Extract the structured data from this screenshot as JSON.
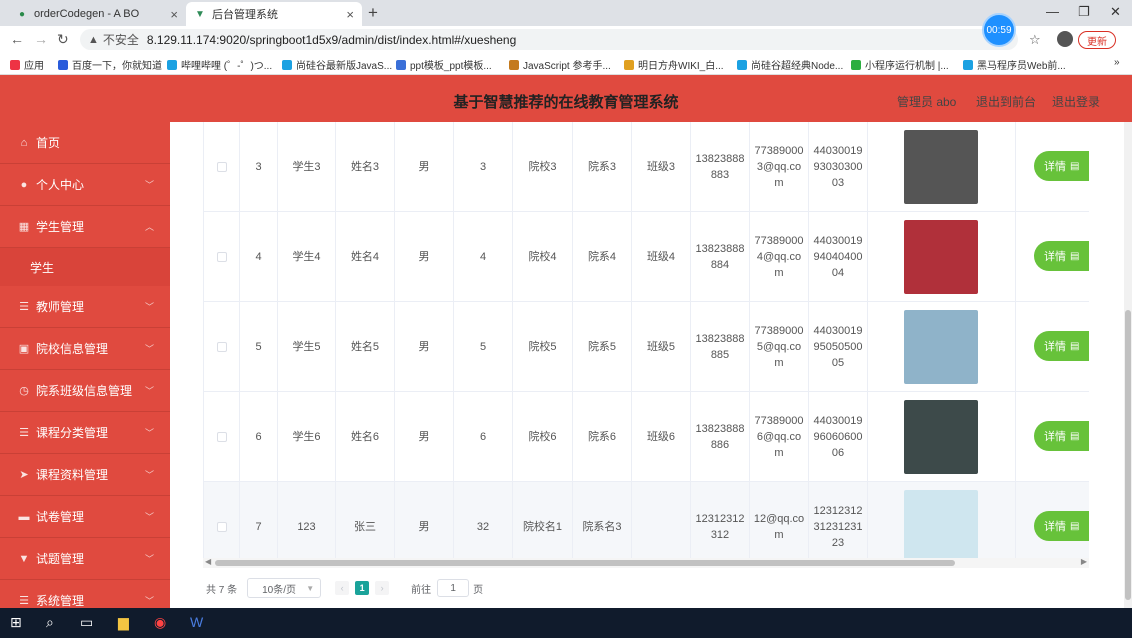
{
  "browser": {
    "tabs": [
      {
        "title": "orderCodegen - A BO",
        "icon": "github-icon"
      },
      {
        "title": "后台管理系统",
        "icon": "vue-icon"
      }
    ],
    "insecure_label": "不安全",
    "url": "8.129.11.174:9020/springboot1d5x9/admin/dist/index.html#/xuesheng",
    "timer": "00:59",
    "update_label": "更新",
    "bookmarks": [
      "应用",
      "百度一下，你就知道",
      "哔哩哔哩 (゜-゜)つ...",
      "尚硅谷最新版JavaS...",
      "ppt模板_ppt模板...",
      "JavaScript 参考手...",
      "明日方舟WIKI_白...",
      "尚硅谷超经典Node...",
      "小程序运行机制 |...",
      "黑马程序员Web前..."
    ]
  },
  "header": {
    "title": "基于智慧推荐的在线教育管理系统",
    "user": "管理员 abo",
    "back_front": "退出到前台",
    "logout": "退出登录"
  },
  "sidebar": {
    "items": [
      {
        "label": "首页",
        "icon": "home-icon"
      },
      {
        "label": "个人中心",
        "icon": "user-icon"
      },
      {
        "label": "学生管理",
        "icon": "grid-icon"
      },
      {
        "label": "教师管理",
        "icon": "list-icon"
      },
      {
        "label": "院校信息管理",
        "icon": "building-icon"
      },
      {
        "label": "院系班级信息管理",
        "icon": "clock-icon"
      },
      {
        "label": "课程分类管理",
        "icon": "list-icon"
      },
      {
        "label": "课程资料管理",
        "icon": "send-icon"
      },
      {
        "label": "试卷管理",
        "icon": "chat-icon"
      },
      {
        "label": "试题管理",
        "icon": "filter-icon"
      },
      {
        "label": "系统管理",
        "icon": "list-icon"
      }
    ],
    "submenu": "学生"
  },
  "table": {
    "rows": [
      {
        "idx": "3",
        "account": "学生3",
        "name": "姓名3",
        "gender": "男",
        "age": "3",
        "school": "院校3",
        "dept": "院系3",
        "class": "班级3",
        "phone": "13823888883",
        "email": "773890003@qq.com",
        "idcard": "440300199303030003",
        "photo_color": "#555555",
        "detail": "详情"
      },
      {
        "idx": "4",
        "account": "学生4",
        "name": "姓名4",
        "gender": "男",
        "age": "4",
        "school": "院校4",
        "dept": "院系4",
        "class": "班级4",
        "phone": "13823888884",
        "email": "773890004@qq.com",
        "idcard": "440300199404040004",
        "photo_color": "#b0303a",
        "detail": "详情"
      },
      {
        "idx": "5",
        "account": "学生5",
        "name": "姓名5",
        "gender": "男",
        "age": "5",
        "school": "院校5",
        "dept": "院系5",
        "class": "班级5",
        "phone": "13823888885",
        "email": "773890005@qq.com",
        "idcard": "440300199505050005",
        "photo_color": "#8fb3c9",
        "detail": "详情"
      },
      {
        "idx": "6",
        "account": "学生6",
        "name": "姓名6",
        "gender": "男",
        "age": "6",
        "school": "院校6",
        "dept": "院系6",
        "class": "班级6",
        "phone": "13823888886",
        "email": "773890006@qq.com",
        "idcard": "440300199606060006",
        "photo_color": "#3d4a4a",
        "detail": "详情"
      },
      {
        "idx": "7",
        "account": "123",
        "name": "张三",
        "gender": "男",
        "age": "32",
        "school": "院校名1",
        "dept": "院系名3",
        "class": "",
        "phone": "12312312312",
        "email": "12@qq.com",
        "idcard": "123123123123123123",
        "photo_color": "#cfe6ef",
        "detail": "详情"
      }
    ]
  },
  "pagination": {
    "total": "共 7 条",
    "page_size": "10条/页",
    "current_page": "1",
    "goto_label": "前往",
    "goto_value": "1",
    "page_label": "页",
    "prev": "‹",
    "next": "›"
  }
}
